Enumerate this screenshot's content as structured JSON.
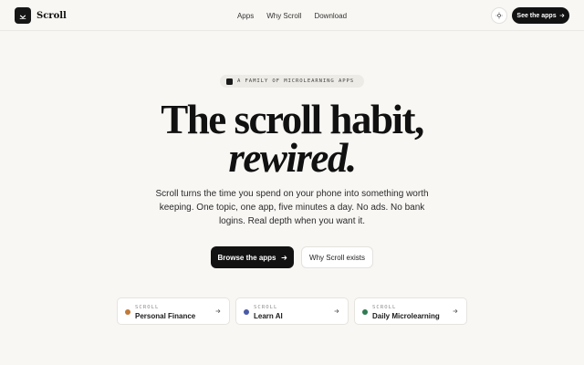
{
  "brand": {
    "name": "Scroll"
  },
  "nav": {
    "items": [
      "Apps",
      "Why Scroll",
      "Download"
    ]
  },
  "header": {
    "cta_label": "See the apps"
  },
  "icons": {
    "logo": "scroll-chevron-logo",
    "theme": "sun-icon",
    "arrow": "arrow-right-icon"
  },
  "hero": {
    "eyebrow": "A FAMILY OF MICROLEARNING APPS",
    "title_line1": "The scroll habit,",
    "title_line2": "rewired.",
    "subtitle": "Scroll turns the time you spend on your phone into something worth keeping. One topic, one app, five minutes a day. No ads. No bank logins. Real depth when you want it.",
    "primary_cta": "Browse the apps",
    "secondary_cta": "Why Scroll exists"
  },
  "cards": [
    {
      "kicker": "SCROLL",
      "title": "Personal Finance",
      "color": "#c07a3a"
    },
    {
      "kicker": "SCROLL",
      "title": "Learn AI",
      "color": "#4a5aa8"
    },
    {
      "kicker": "SCROLL",
      "title": "Daily Microlearning",
      "color": "#2f7a52"
    }
  ],
  "colors": {
    "background": "#f8f7f4",
    "accent": "#121212"
  }
}
